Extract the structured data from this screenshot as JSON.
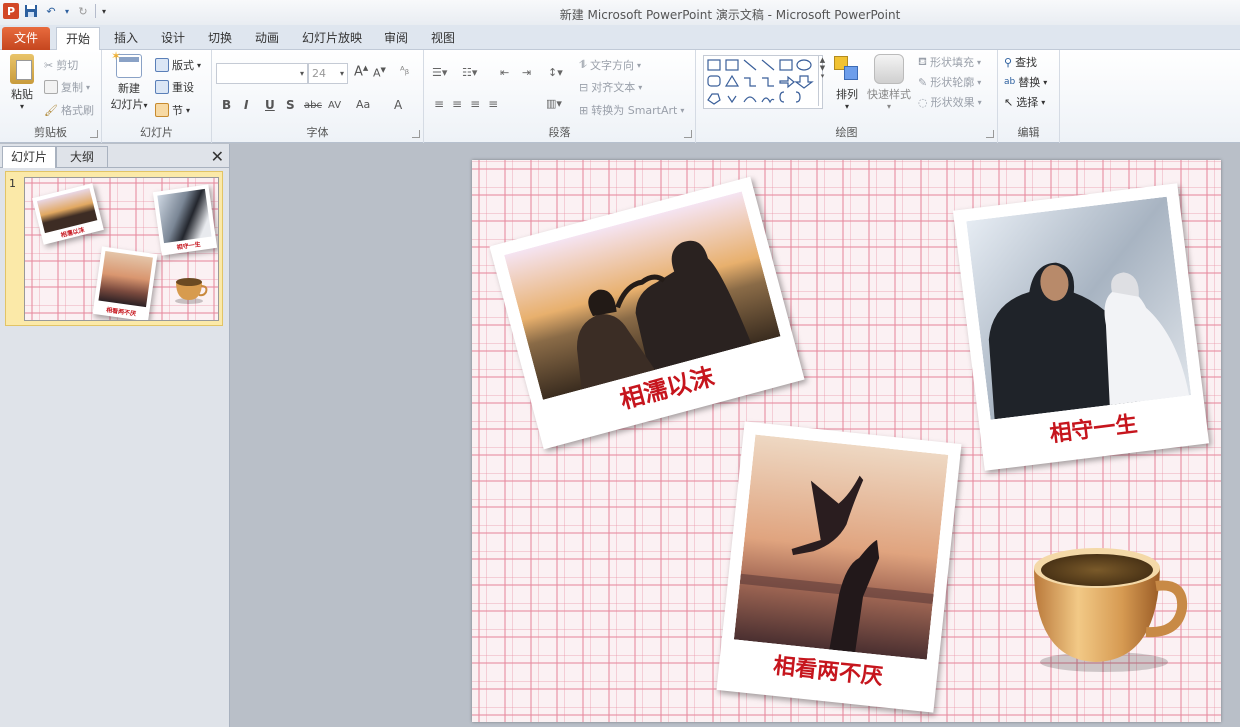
{
  "window": {
    "title": "新建 Microsoft PowerPoint 演示文稿 - Microsoft PowerPoint",
    "app_logo": "P"
  },
  "ribbon_tabs": [
    "文件",
    "开始",
    "插入",
    "设计",
    "切换",
    "动画",
    "幻灯片放映",
    "审阅",
    "视图"
  ],
  "ribbon": {
    "clipboard": {
      "label": "剪贴板",
      "paste": "粘贴",
      "cut": "剪切",
      "copy": "复制",
      "format_painter": "格式刷"
    },
    "slides": {
      "label": "幻灯片",
      "new_slide_line1": "新建",
      "new_slide_line2": "幻灯片",
      "layout": "版式",
      "reset": "重设",
      "section": "节"
    },
    "font": {
      "label": "字体",
      "font_name": "",
      "font_size": "24",
      "bold": "B",
      "italic": "I",
      "underline": "U",
      "shadow": "S",
      "strike": "abc",
      "spacing": "AV",
      "case": "Aa",
      "color": "A"
    },
    "paragraph": {
      "label": "段落",
      "text_direction": "文字方向",
      "align_text": "对齐文本",
      "smartart": "转换为 SmartArt"
    },
    "drawing": {
      "label": "绘图",
      "arrange": "排列",
      "quick_styles": "快速样式",
      "shape_fill": "形状填充",
      "shape_outline": "形状轮廓",
      "shape_effects": "形状效果"
    },
    "editing": {
      "label": "编辑",
      "find": "查找",
      "replace": "替换",
      "select": "选择"
    }
  },
  "left_pane": {
    "tabs": [
      "幻灯片",
      "大纲"
    ],
    "slide_number": "1"
  },
  "slide": {
    "captions": {
      "photo1": "相濡以沫",
      "photo2": "相守一生",
      "photo3": "相看两不厌"
    }
  },
  "colors": {
    "caption_red": "#c6151d",
    "file_tab": "#d24726",
    "plaid_pink": "#e78ca0"
  }
}
